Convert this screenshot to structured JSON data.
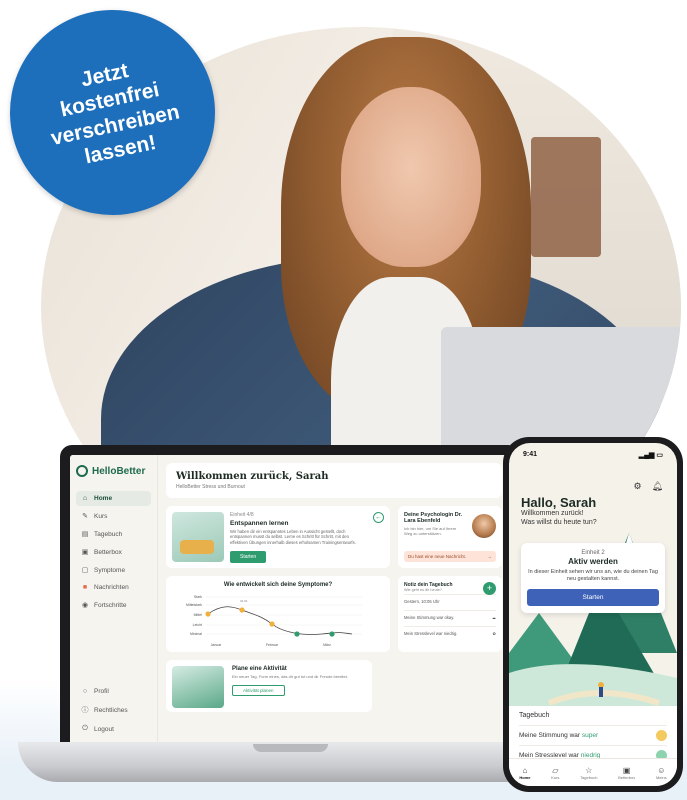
{
  "badge": {
    "lines": [
      "Jetzt",
      "kostenfrei",
      "verschreiben",
      "lassen!"
    ]
  },
  "laptop": {
    "logo": "HelloBetter",
    "nav": [
      "Home",
      "Kurs",
      "Tagebuch",
      "Betterbox",
      "Symptome",
      "Nachrichten",
      "Fortschritte"
    ],
    "nav_bottom": [
      "Profil",
      "Rechtliches",
      "Logout"
    ],
    "welcome_title": "Willkommen zurück, Sarah",
    "welcome_sub": "HelloBetter Stress und Burnout",
    "unit": {
      "label": "Einheit 4/8",
      "title": "Entspannen lernen",
      "body": "Wir haben dir ein entspanntes Leben in Aussicht gestellt, doch entspannen musst du selbst. Lerne es Schritt für Schritt, mit den effektiven Übungen innerhalb dieses erholsamen Trainingsentwurfs.",
      "button": "Starten"
    },
    "psych": {
      "title": "Deine Psychologin Dr. Lara Ebenfeld",
      "body": "Ich bin hier, um Sie auf Ihrem Weg zu unterstützen.",
      "message": "Du hast eine neue Nachricht."
    },
    "chart": {
      "title": "Wie entwickelt sich deine Symptome?",
      "ylabels": [
        "Stark",
        "Mittelstark",
        "Mittel",
        "Leicht",
        "Minimal"
      ],
      "xlabels": [
        "Januar",
        "Februar",
        "März"
      ],
      "callout": "31.01"
    },
    "diary": {
      "title": "Notiz dein Tagebuch",
      "sub": "Wie geht es dir heute?",
      "date": "Gestern, 10:05 Uhr",
      "mood": "Meine Stimmung war okay.",
      "stress": "Mein Stresslevel war niedrig."
    },
    "plan": {
      "title": "Plane eine Aktivität",
      "body": "Ein neuer Tag, Form eines, das dir gut tut und dir Freude bereitet.",
      "button": "Aktivität planen"
    }
  },
  "phone": {
    "time": "9:41",
    "greeting": "Hallo, Sarah",
    "sub1": "Willkommen zurück!",
    "sub2": "Was willst du heute tun?",
    "unit_label": "Einheit 2",
    "unit_title": "Aktiv werden",
    "unit_body": "In dieser Einheit sehen wir uns an, wie du deinen Tag neu gestalten kannst.",
    "button": "Starten",
    "diary_header": "Tagebuch",
    "mood_prefix": "Meine Stimmung war",
    "mood_value": "super",
    "stress_prefix": "Mein Stresslevel war",
    "stress_value": "niedrig",
    "tabs": [
      "Home",
      "Kurs",
      "Tagebuch",
      "Betterbox",
      "Meins"
    ]
  },
  "colors": {
    "brand_green": "#2e9c6e",
    "badge_blue": "#1e6fbb",
    "button_blue": "#3d62b8"
  }
}
